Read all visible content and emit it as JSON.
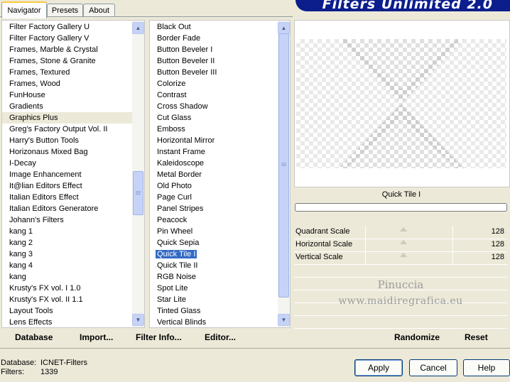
{
  "tabs": [
    {
      "label": "Navigator",
      "active": true
    },
    {
      "label": "Presets",
      "active": false
    },
    {
      "label": "About",
      "active": false
    }
  ],
  "banner": {
    "title": "Filters Unlimited 2.0",
    "color": "#0c1e8c"
  },
  "categories": {
    "items": [
      "Filter Factory Gallery U",
      "Filter Factory Gallery V",
      "Frames, Marble & Crystal",
      "Frames, Stone & Granite",
      "Frames, Textured",
      "Frames, Wood",
      "FunHouse",
      "Gradients",
      "Graphics Plus",
      "Greg's Factory Output Vol. II",
      "Harry's Button Tools",
      "Horizonaus Mixed Bag",
      "I-Decay",
      "Image Enhancement",
      "It@lian Editors Effect",
      "Italian Editors Effect",
      "Italian Editors Generatore",
      "Johann's Filters",
      "kang 1",
      "kang 2",
      "kang 3",
      "kang 4",
      "kang",
      "Krusty's FX vol. I 1.0",
      "Krusty's FX vol. II 1.1",
      "Layout Tools",
      "Lens Effects"
    ],
    "highlighted": "Graphics Plus"
  },
  "filters": {
    "items": [
      "Black Out",
      "Border Fade",
      "Button Beveler I",
      "Button Beveler II",
      "Button Beveler III",
      "Colorize",
      "Contrast",
      "Cross Shadow",
      "Cut Glass",
      "Emboss",
      "Horizontal Mirror",
      "Instant Frame",
      "Kaleidoscope",
      "Metal Border",
      "Old Photo",
      "Page Curl",
      "Panel Stripes",
      "Peacock",
      "Pin Wheel",
      "Quick Sepia",
      "Quick Tile I",
      "Quick Tile II",
      "RGB Noise",
      "Spot Lite",
      "Star Lite",
      "Tinted Glass",
      "Vertical Blinds"
    ],
    "selected": "Quick Tile I"
  },
  "preview": {
    "filter_name": "Quick Tile I"
  },
  "params": [
    {
      "label": "Quadrant Scale",
      "value": "128"
    },
    {
      "label": "Horizontal Scale",
      "value": "128"
    },
    {
      "label": "Vertical Scale",
      "value": "128"
    }
  ],
  "watermark": {
    "line1": "Pinuccia",
    "line2": "www.maidiregrafica.eu"
  },
  "links": {
    "database": "Database",
    "import": "Import...",
    "filter_info": "Filter Info...",
    "editor": "Editor...",
    "randomize": "Randomize",
    "reset": "Reset"
  },
  "status": {
    "database_label": "Database:",
    "database_value": "ICNET-Filters",
    "filters_label": "Filters:",
    "filters_value": "1339"
  },
  "buttons": {
    "apply": "Apply",
    "cancel": "Cancel",
    "help": "Help"
  },
  "icons": {
    "scroll_up": "chevron-up-icon",
    "scroll_down": "chevron-down-icon"
  }
}
